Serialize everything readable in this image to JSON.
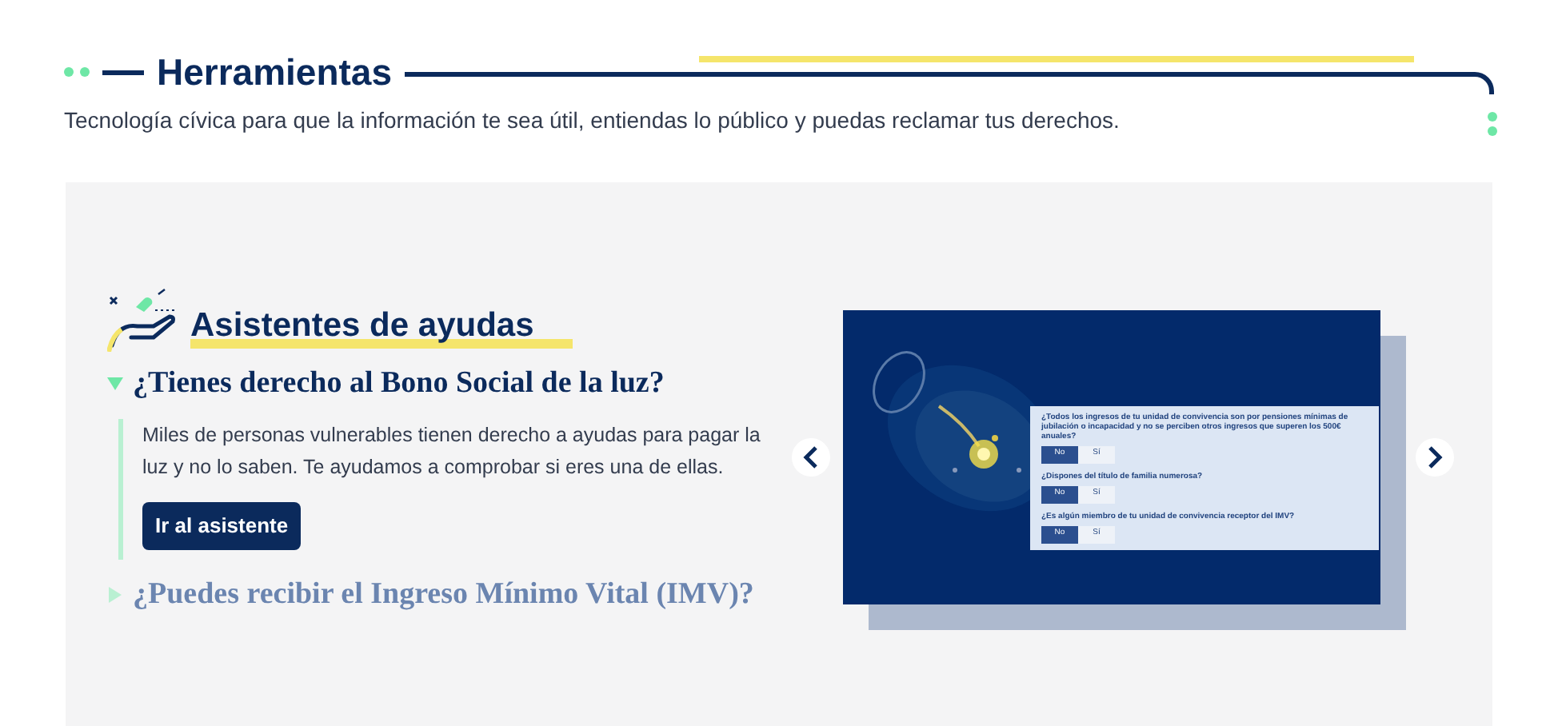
{
  "header": {
    "title": "Herramientas",
    "subtitle": "Tecnología cívica para que la información te sea útil, entiendas lo público y puedas reclamar tus derechos."
  },
  "section": {
    "title": "Asistentes de ayudas",
    "items": [
      {
        "question": "¿Tienes derecho al Bono Social de la luz?",
        "expanded": true,
        "description": "Miles de personas vulnerables tienen derecho a ayudas para pagar la luz y no lo saben. Te ayudamos a comprobar si eres una de ellas.",
        "button": "Ir al asistente"
      },
      {
        "question": "¿Puedes recibir el Ingreso Mínimo Vital (IMV)?",
        "expanded": false
      }
    ]
  },
  "slide": {
    "questions": [
      {
        "text": "¿Todos los ingresos de tu unidad de convivencia son por pensiones mínimas de jubilación o incapacidad y no se perciben otros ingresos que superen los 500€ anuales?",
        "options": [
          {
            "label": "No",
            "selected": true
          },
          {
            "label": "Sí",
            "selected": false
          }
        ]
      },
      {
        "text": "¿Dispones del título de familia numerosa?",
        "options": [
          {
            "label": "No",
            "selected": true
          },
          {
            "label": "Sí",
            "selected": false
          }
        ]
      },
      {
        "text": "¿Es algún miembro de tu unidad de convivencia receptor del IMV?",
        "options": [
          {
            "label": "No",
            "selected": true
          },
          {
            "label": "Sí",
            "selected": false
          }
        ]
      }
    ]
  }
}
